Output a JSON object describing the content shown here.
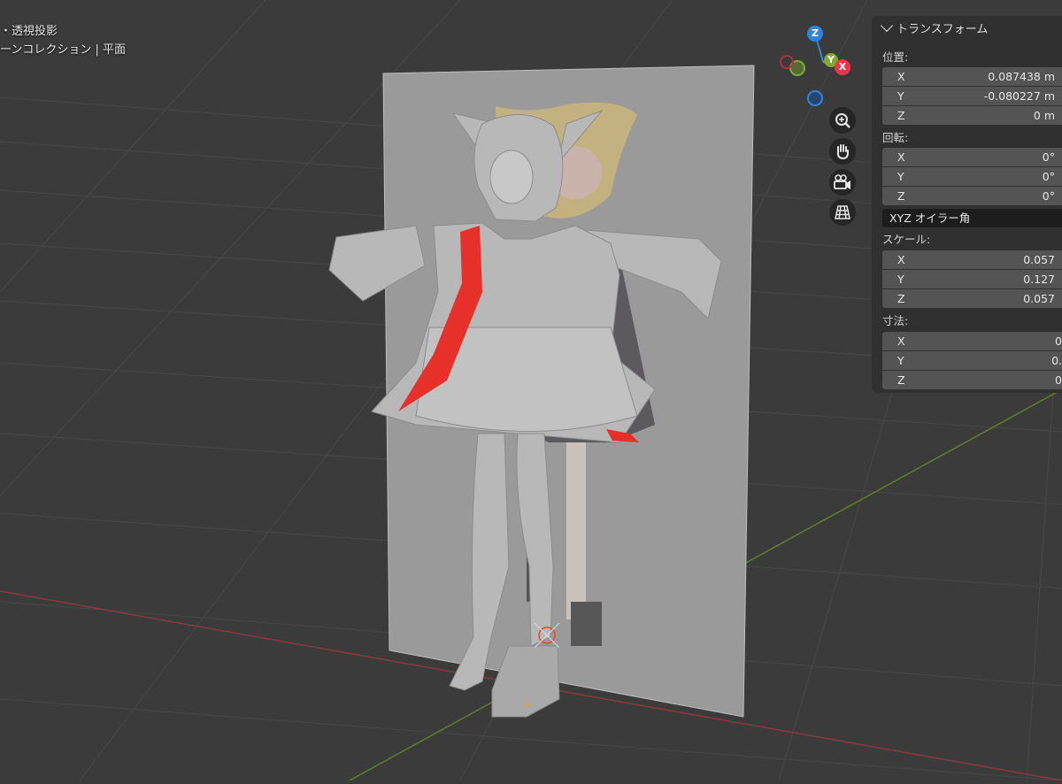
{
  "header": {
    "view_mode": "・透視投影",
    "collection_path": "ーンコレクション | 平面"
  },
  "gizmo": {
    "z_label": "Z",
    "y_label": "Y",
    "x_label": "X",
    "colors": {
      "x": "#e8364c",
      "y": "#7eab2d",
      "z": "#2f84e0"
    }
  },
  "nav_buttons": [
    "zoom-icon",
    "hand-pan-icon",
    "camera-icon",
    "grid-toggle-icon"
  ],
  "transform_panel": {
    "title": "トランスフォーム",
    "location": {
      "label": "位置:",
      "x_axis": "X",
      "x": "0.087438 m",
      "y_axis": "Y",
      "y": "-0.080227 m",
      "z_axis": "Z",
      "z": "0 m"
    },
    "rotation": {
      "label": "回転:",
      "x_axis": "X",
      "x": "0°",
      "y_axis": "Y",
      "y": "0°",
      "z_axis": "Z",
      "z": "0°",
      "mode": "XYZ オイラー角"
    },
    "scale": {
      "label": "スケール:",
      "x_axis": "X",
      "x": "0.057",
      "y_axis": "Y",
      "y": "0.127",
      "z_axis": "Z",
      "z": "0.057"
    },
    "dimensions": {
      "label": "寸法:",
      "x_axis": "X",
      "x": "0",
      "y_axis": "Y",
      "y": "0.",
      "z_axis": "Z",
      "z": "0"
    }
  }
}
